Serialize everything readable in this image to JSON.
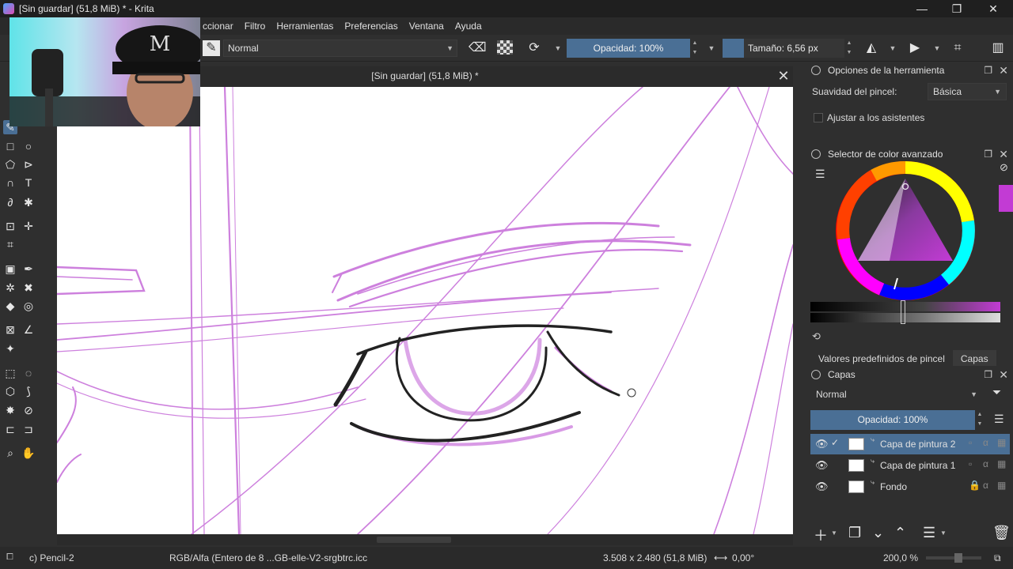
{
  "window": {
    "title": "[Sin guardar]  (51,8 MiB) * - Krita",
    "minimize": "—",
    "maximize": "❐",
    "close": "✕"
  },
  "menu": [
    "ccionar",
    "Filtro",
    "Herramientas",
    "Preferencias",
    "Ventana",
    "Ayuda"
  ],
  "toolbar": {
    "blend_mode": "Normal",
    "opacity_label": "Opacidad: 100%",
    "size_label": "Tamaño: 6,56 px",
    "icons": [
      "brush-preset-icon",
      "eraser-icon",
      "alpha-lock-icon",
      "reload-icon",
      "mirror-horizontal-icon",
      "mirror-vertical-icon",
      "wrap-icon",
      "workspace-icon"
    ]
  },
  "document": {
    "tab_title": "[Sin guardar]  (51,8 MiB) *"
  },
  "tool_options": {
    "title": "Opciones de la herramienta",
    "smoothing_label": "Suavidad del pincel:",
    "smoothing_value": "Básica",
    "assistant_label": "Ajustar a los asistentes"
  },
  "color_selector": {
    "title": "Selector de color avanzado",
    "accent": "#c23bd4"
  },
  "layers_dock": {
    "tabs": [
      "Valores predefinidos de pincel",
      "Capas"
    ],
    "title": "Capas",
    "blend_mode": "Normal",
    "opacity_label": "Opacidad:  100%",
    "layers": [
      {
        "name": "Capa de pintura 2",
        "selected": true
      },
      {
        "name": "Capa de pintura 1",
        "selected": false
      },
      {
        "name": "Fondo",
        "selected": false
      }
    ]
  },
  "status": {
    "brush": "c) Pencil-2",
    "color_space": "RGB/Alfa (Entero de 8 ...GB-elle-V2-srgbtrc.icc",
    "image_size": "3.508 x 2.480 (51,8 MiB)",
    "rotation": "0,00°",
    "zoom": "200,0 %"
  },
  "colors": {
    "accent_blue": "#4a6f95",
    "sketch_purple": "#c56bd8",
    "ink": "#222222"
  }
}
